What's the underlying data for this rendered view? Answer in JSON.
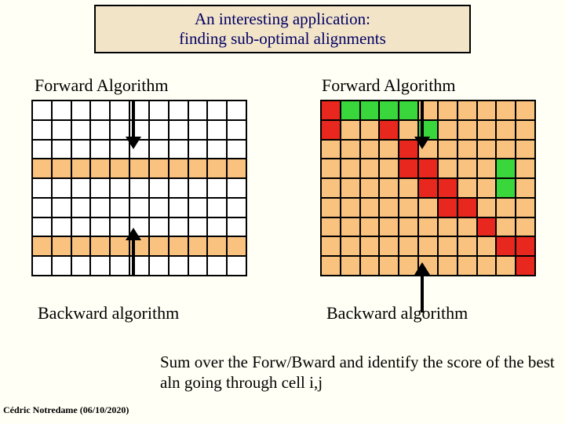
{
  "title": {
    "line1": "An interesting application:",
    "line2": "finding sub-optimal alignments"
  },
  "left": {
    "top_label": "Forward Algorithm",
    "bottom_label": "Backward algorithm"
  },
  "right": {
    "top_label": "Forward Algorithm",
    "bottom_label": "Backward algorithm"
  },
  "summary": "Sum over the Forw/Bward and identify the score of the best aln going through cell i,j",
  "footer": "Cédric Notredame (06/10/2020)",
  "grids": {
    "left": [
      [
        "w",
        "w",
        "w",
        "w",
        "w",
        "w",
        "w",
        "w",
        "w",
        "w",
        "w"
      ],
      [
        "w",
        "w",
        "w",
        "w",
        "w",
        "w",
        "w",
        "w",
        "w",
        "w",
        "w"
      ],
      [
        "w",
        "w",
        "w",
        "w",
        "w",
        "w",
        "w",
        "w",
        "w",
        "w",
        "w"
      ],
      [
        "o",
        "o",
        "o",
        "o",
        "o",
        "o",
        "o",
        "o",
        "o",
        "o",
        "o"
      ],
      [
        "w",
        "w",
        "w",
        "w",
        "w",
        "w",
        "w",
        "w",
        "w",
        "w",
        "w"
      ],
      [
        "w",
        "w",
        "w",
        "w",
        "w",
        "w",
        "w",
        "w",
        "w",
        "w",
        "w"
      ],
      [
        "w",
        "w",
        "w",
        "w",
        "w",
        "w",
        "w",
        "w",
        "w",
        "w",
        "w"
      ],
      [
        "o",
        "o",
        "o",
        "o",
        "o",
        "o",
        "o",
        "o",
        "o",
        "o",
        "o"
      ],
      [
        "w",
        "w",
        "w",
        "w",
        "w",
        "w",
        "w",
        "w",
        "w",
        "w",
        "w"
      ]
    ],
    "right": [
      [
        "r",
        "g",
        "g",
        "g",
        "g",
        "o",
        "o",
        "o",
        "o",
        "o",
        "o"
      ],
      [
        "r",
        "o",
        "o",
        "r",
        "o",
        "g",
        "o",
        "o",
        "o",
        "o",
        "o"
      ],
      [
        "o",
        "o",
        "o",
        "o",
        "r",
        "o",
        "o",
        "o",
        "o",
        "o",
        "o"
      ],
      [
        "o",
        "o",
        "o",
        "o",
        "r",
        "r",
        "o",
        "o",
        "o",
        "g",
        "o"
      ],
      [
        "o",
        "o",
        "o",
        "o",
        "o",
        "r",
        "r",
        "o",
        "o",
        "g",
        "o"
      ],
      [
        "o",
        "o",
        "o",
        "o",
        "o",
        "o",
        "r",
        "r",
        "o",
        "o",
        "o"
      ],
      [
        "o",
        "o",
        "o",
        "o",
        "o",
        "o",
        "o",
        "o",
        "r",
        "o",
        "o"
      ],
      [
        "o",
        "o",
        "o",
        "o",
        "o",
        "o",
        "o",
        "o",
        "o",
        "r",
        "r"
      ],
      [
        "o",
        "o",
        "o",
        "o",
        "o",
        "o",
        "o",
        "o",
        "o",
        "o",
        "r"
      ]
    ]
  }
}
